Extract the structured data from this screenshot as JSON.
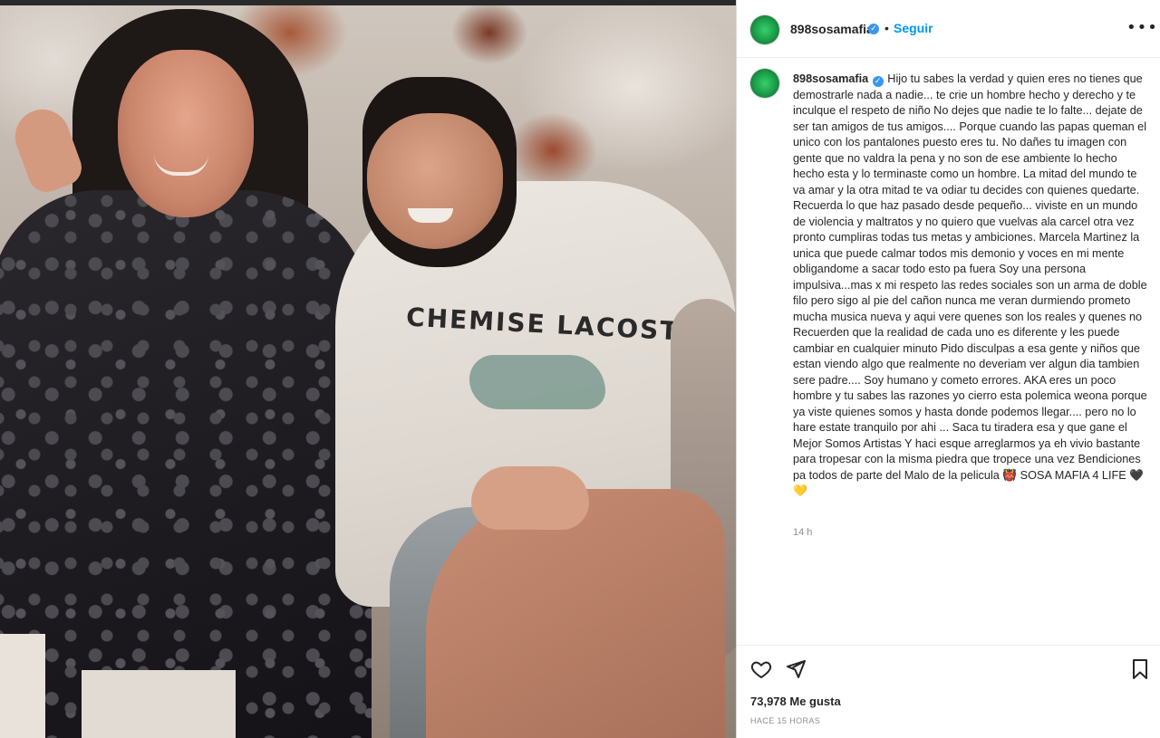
{
  "post": {
    "username": "898sosamafia",
    "follow_label": "Seguir",
    "separator": "•",
    "more_label": "•••",
    "verified_mark": "✓",
    "photo_shirt_text": "CHEMISE LACOSTE"
  },
  "caption": {
    "username": "898sosamafia",
    "text": "Hijo tu sabes la verdad y quien eres no tienes que demostrarle nada a nadie... te crie un hombre hecho y derecho y te inculque el respeto de niño No dejes que nadie te lo falte... dejate de ser tan amigos de tus amigos.... Porque cuando las papas queman el unico con los pantalones puesto eres tu. No dañes tu imagen con gente que no valdra la pena y no son de ese ambiente lo hecho hecho esta y lo terminaste como un hombre. La mitad del mundo te va amar y la otra mitad te va odiar tu decides con quienes quedarte. Recuerda lo que haz pasado desde pequeño... viviste en un mundo de violencia y maltratos y no quiero que vuelvas ala carcel otra vez pronto cumpliras todas tus metas y ambiciones. Marcela Martinez la unica que puede calmar todos mis demonio y voces en mi mente obligandome a sacar todo esto pa fuera Soy una persona impulsiva...mas x mi respeto las redes sociales son un arma de doble filo pero sigo al pie del cañon nunca me veran durmiendo prometo mucha musica nueva y aqui vere quenes son los reales y quenes no\nRecuerden que la realidad de cada uno es diferente y les puede cambiar en cualquier minuto Pido disculpas a esa gente y niños que estan viendo algo que realmente no deveriam ver algun dia tambien sere padre.... Soy humano y cometo errores. AKA eres un poco hombre y tu sabes las razones yo cierro esta polemica weona porque ya viste quienes somos y hasta donde podemos llegar.... pero no lo hare estate tranquilo por ahi ... Saca tu tiradera esa y que gane el Mejor Somos Artistas Y haci esque arreglarmos ya eh vivio bastante para tropesar con la misma piedra que tropece una vez Bendiciones pa todos de parte del Malo de la pelicula 👹 SOSA MAFIA 4 LIFE 🖤💛",
    "time": "14 h"
  },
  "engagement": {
    "likes": "73,978 Me gusta",
    "date": "HACE 15 HORAS"
  },
  "icons": {
    "like": "heart-icon",
    "share": "paper-plane-icon",
    "save": "bookmark-icon",
    "more": "more-options-icon",
    "verified": "verified-badge-icon"
  },
  "colors": {
    "accent": "#0095f6",
    "verified": "#3897f0",
    "text": "#262626",
    "muted": "#8e8e8e",
    "avatar": "#1b9a48"
  }
}
